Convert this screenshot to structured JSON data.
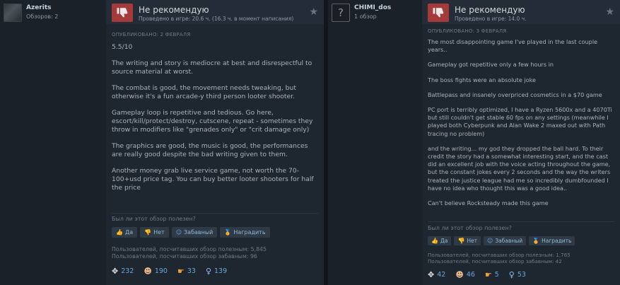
{
  "reviews": [
    {
      "author": {
        "name": "Azerits",
        "count": "Обзоров: 2"
      },
      "verdict": "Не рекомендую",
      "hours": "Проведено в игре: 20.6 ч. (16.3 ч. в момент написания)",
      "posted": "ОПУБЛИКОВАНО: 2 ФЕВРАЛЯ",
      "paragraphs": [
        "5.5/10",
        "The writing and story is mediocre at best and disrespectful to source material at worst.",
        "The combat is good, the movement needs tweaking, but otherwise it's a fun arcade-y third person looter shooter.",
        "Gameplay loop is repetitive and tedious. Go here, escort/kill/protect/destroy, cutscene, repeat - sometimes they throw in modifiers like \"grenades only\" or \"crit damage only)",
        "The graphics are good, the music is good, the performances are really good despite the bad writing given to them.",
        "Another money grab live service game, not worth the 70-100+usd price tag. You can buy better looter shooters for half the price"
      ],
      "helpful_q": "Был ли этот обзор полезен?",
      "buttons": {
        "yes": "Да",
        "no": "Нет",
        "funny": "Забавный",
        "award": "Наградить"
      },
      "stats": [
        "Пользователей, посчитавших обзор полезным: 5,845",
        "Пользователей, посчитавших обзор забавным: 96"
      ],
      "awards": [
        "232",
        "190",
        "33",
        "139"
      ]
    },
    {
      "author": {
        "name": "CHIMI_dos",
        "count": "1 обзор"
      },
      "verdict": "Не рекомендую",
      "hours": "Проведено в игре: 14.0 ч.",
      "posted": "ОПУБЛИКОВАНО: 3 ФЕВРАЛЯ",
      "paragraphs": [
        "The most disappointing game I've played in the last couple years..",
        "Gameplay got repetitive only a few hours in",
        "The boss fights were an absolute joke",
        "Battlepass and insanely overpriced cosmetics in a $70 game",
        "PC port is terribly optimized, I have a Ryzen 5600x and a 4070Ti but still couldn't get stable 60 fps on any settings (meanwhile I played both Cyberpunk and Alan Wake 2 maxed out with Path tracing no problem)",
        "and the writing... my god they dropped the ball hard. To their credit the story had a somewhat interesting start, and the cast did an excellent job with the voice acting throughout the game, but the constant jokes every 2 seconds and the way the writers treated the justice league had me so incredibly dumbfounded I have no idea who thought this was a good idea..",
        "Can't believe Rocksteady made this game"
      ],
      "helpful_q": "Был ли этот обзор полезен?",
      "buttons": {
        "yes": "Да",
        "no": "Нет",
        "funny": "Забавный",
        "award": "Наградить"
      },
      "stats": [
        "Пользователей, посчитавших обзор полезным: 1,765",
        "Пользователей, посчитавших обзор забавным: 42"
      ],
      "awards": [
        "42",
        "46",
        "5",
        "53"
      ]
    }
  ],
  "icons": [
    "thumbs-down-icon",
    "star-icon",
    "thumbs-up-icon",
    "smiley-icon",
    "award-icon",
    "wings-icon",
    "clown-icon",
    "pointing-hand-icon",
    "trophy-icon"
  ],
  "colors": {
    "thumb_down": "#a53a3a",
    "link": "#67a8dc",
    "award_gold": "#e4b73f"
  }
}
